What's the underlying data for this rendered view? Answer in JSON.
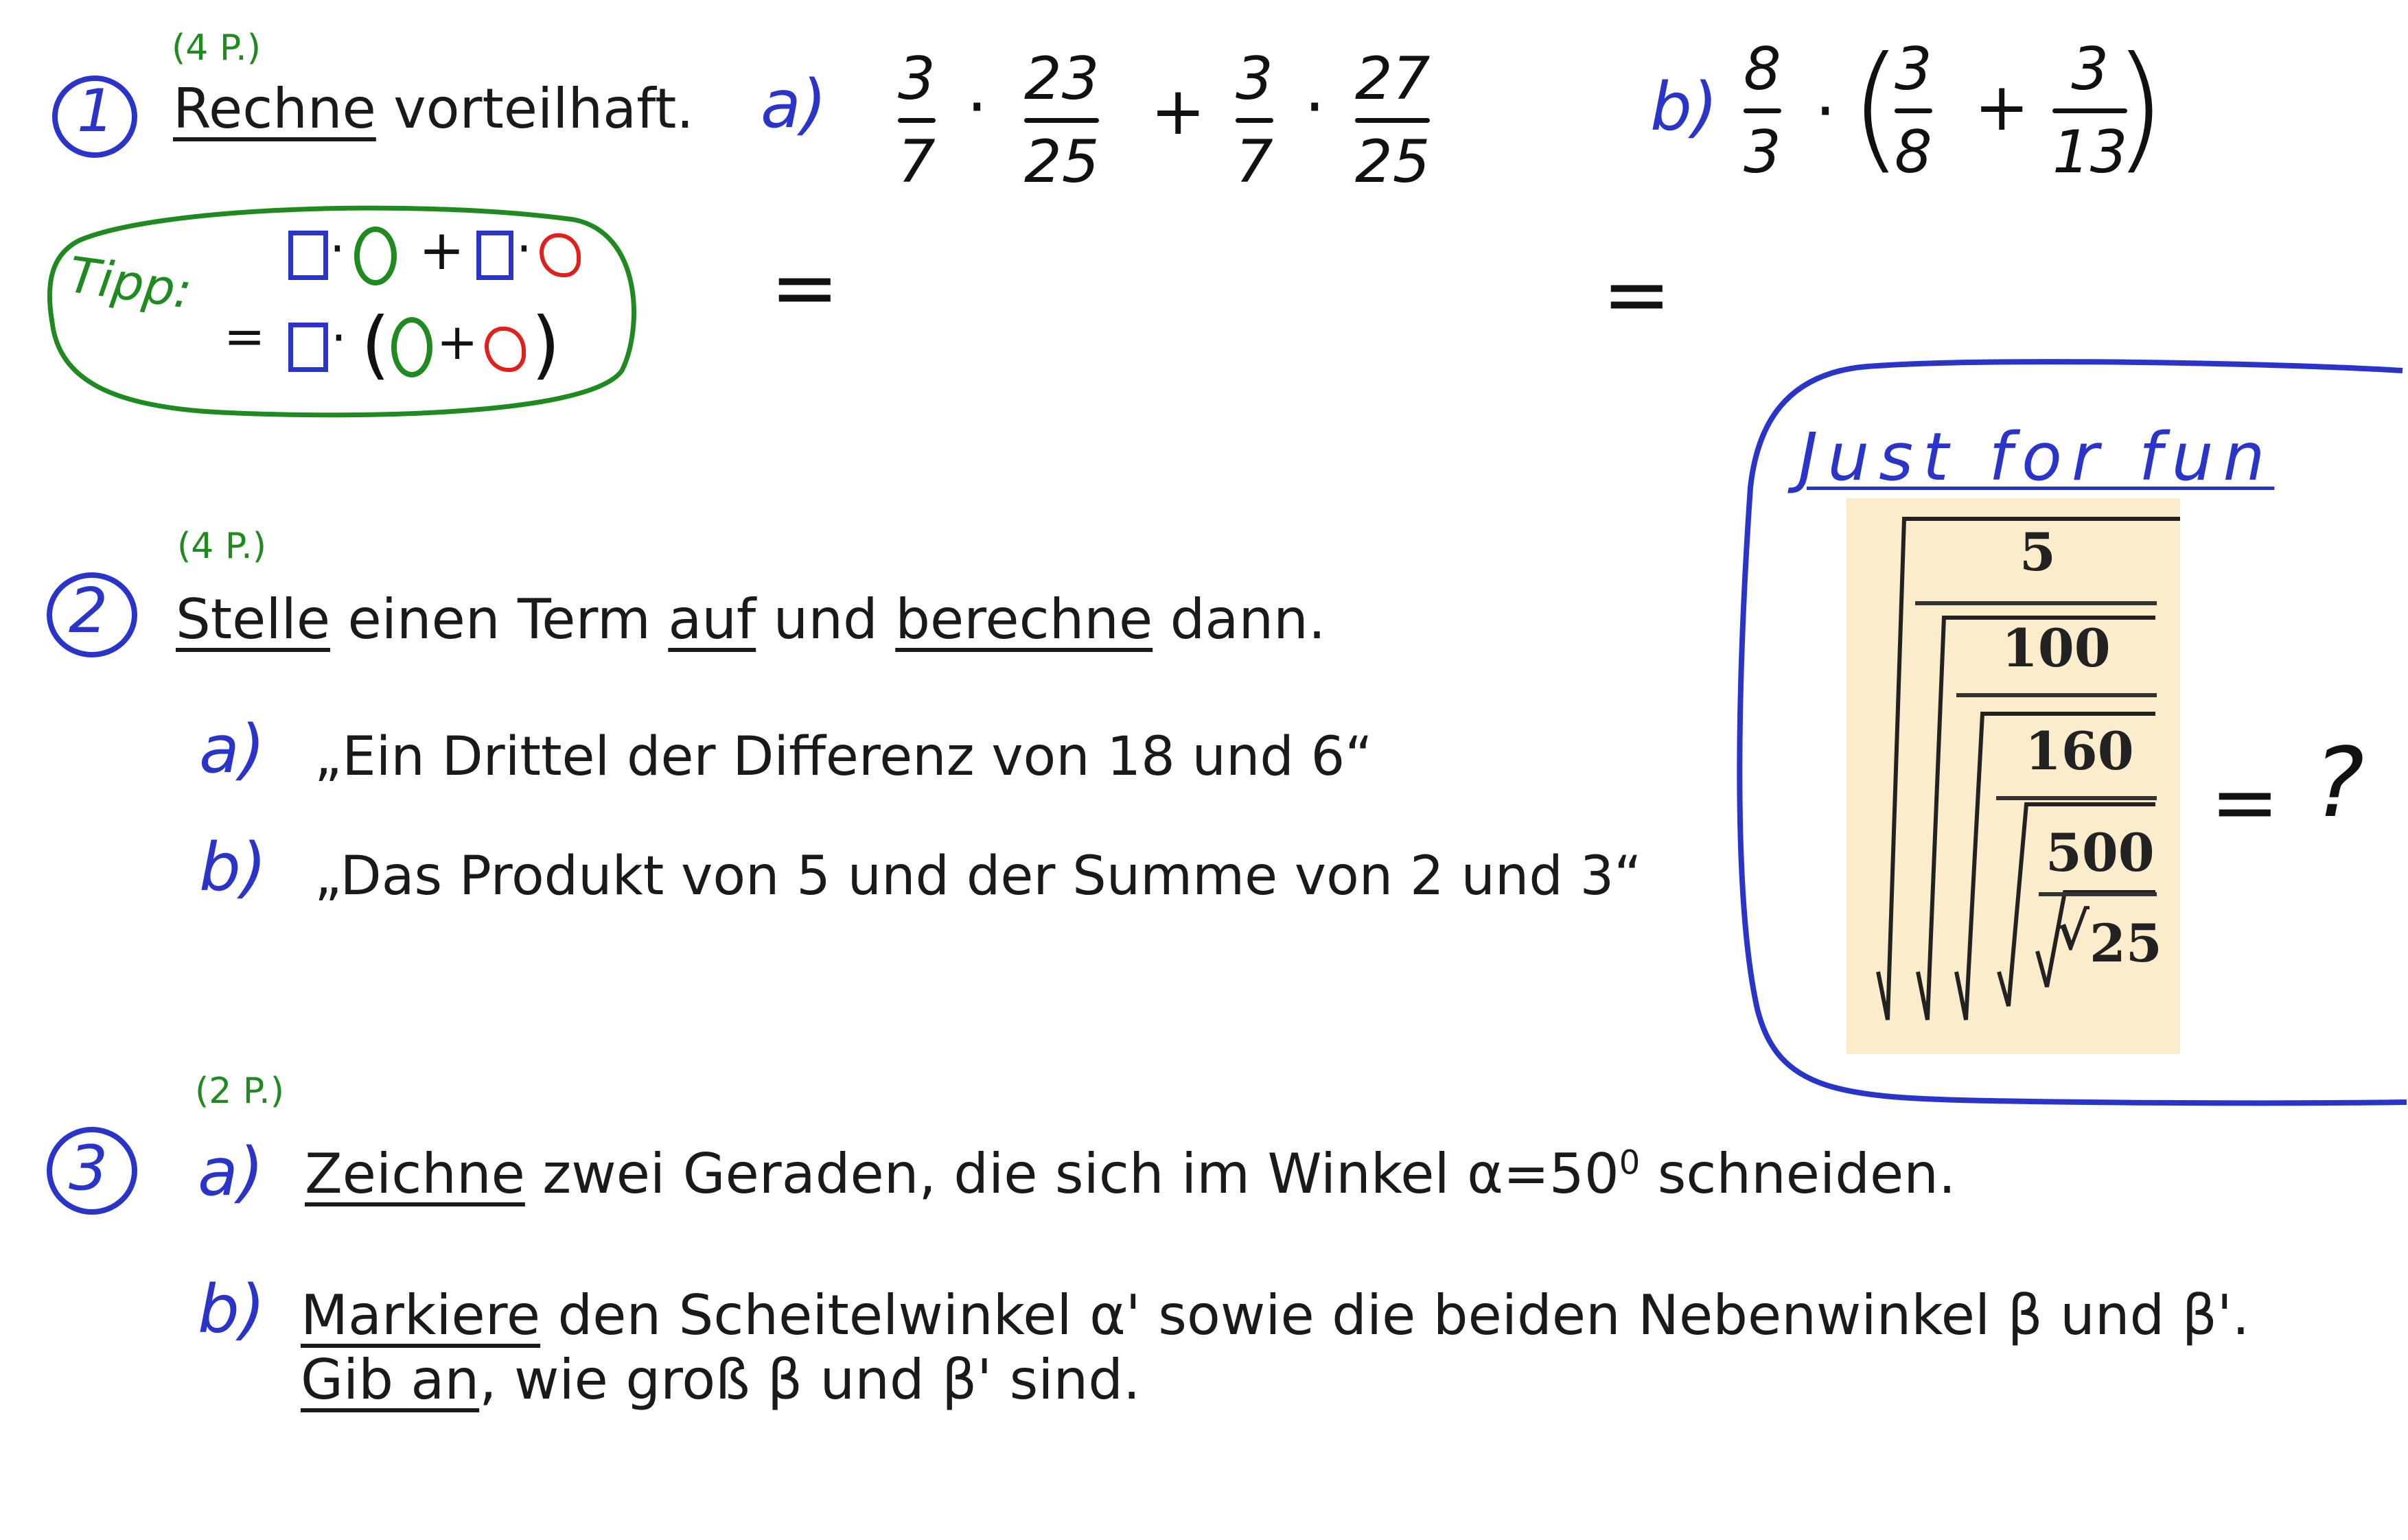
{
  "task1": {
    "number": "1",
    "points": "(4 P.)",
    "instruction_verb": "Rechne",
    "instruction_rest": " vorteilhaft.",
    "part_a_label": "a)",
    "part_a": {
      "f1": {
        "num": "3",
        "den": "7"
      },
      "f2": {
        "num": "23",
        "den": "25"
      },
      "plus": "+",
      "f3": {
        "num": "3",
        "den": "7"
      },
      "f4": {
        "num": "27",
        "den": "25"
      },
      "dot": "·",
      "equals": "="
    },
    "part_b_label": "b)",
    "part_b": {
      "f1": {
        "num": "8",
        "den": "3"
      },
      "dot": "·",
      "open": "(",
      "f2": {
        "num": "3",
        "den": "8"
      },
      "plus": "+",
      "f3": {
        "num": "3",
        "den": "13"
      },
      "close": ")",
      "equals": "="
    },
    "tip": {
      "label": "Tipp:",
      "line1_dot": "·",
      "line1_plus": "+",
      "line2_eq": "=",
      "line2_open": "(",
      "line2_plus": "+",
      "line2_close": ")"
    }
  },
  "task2": {
    "number": "2",
    "points": "(4 P.)",
    "verb1": "Stelle",
    "mid1": " einen Term ",
    "verb2": "auf",
    "mid2": " und ",
    "verb3": "berechne",
    "end": " dann.",
    "a_label": "a)",
    "a_text": "„Ein Drittel der Differenz von 18 und 6“",
    "b_label": "b)",
    "b_text": "„Das Produkt von 5 und der Summe von 2 und 3“"
  },
  "fun_box": {
    "title": "Just for fun",
    "values": [
      "5",
      "100",
      "160",
      "500",
      "25"
    ],
    "radical": "√",
    "equals": "=",
    "question": "?"
  },
  "task3": {
    "number": "3",
    "points": "(2 P.)",
    "a_label": "a)",
    "a_verb": "Zeichne",
    "a_rest": " zwei Geraden, die sich im Winkel α=50",
    "a_sup": "0",
    "a_end": " schneiden.",
    "b_label": "b)",
    "b_verb": "Markiere",
    "b_rest": " den Scheitelwinkel α' sowie die beiden Nebenwinkel β und β'.",
    "b2_verb": "Gib an",
    "b2_rest": ", wie groß β und β' sind."
  },
  "colors": {
    "ink_blue": "#2b34c8",
    "points_green": "#1f8a1f",
    "blob_red": "#e0201b",
    "puzzle_bg": "#fbeccb"
  }
}
